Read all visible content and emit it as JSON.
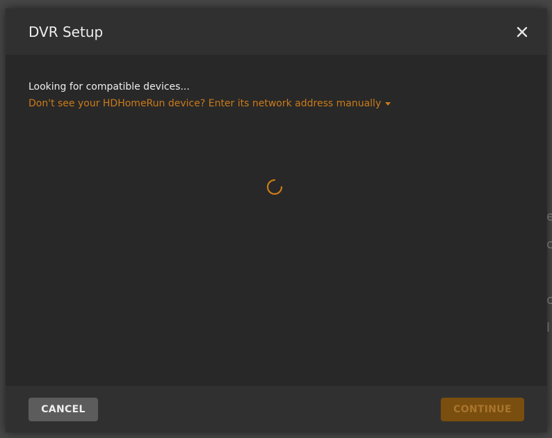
{
  "modal": {
    "title": "DVR Setup"
  },
  "body": {
    "status": "Looking for compatible devices...",
    "manual_link": "Don't see your HDHomeRun device? Enter its network address manually"
  },
  "footer": {
    "cancel_label": "CANCEL",
    "continue_label": "CONTINUE",
    "continue_disabled": true
  },
  "background": {
    "glyphs": [
      "e",
      "c",
      "c",
      "l"
    ]
  },
  "icons": {
    "close": "close-icon",
    "spinner": "loading-spinner-icon",
    "caret": "caret-down-icon"
  },
  "colors": {
    "accent": "#cc7b19",
    "modal_bg": "#282828",
    "header_bg": "#303030",
    "cancel_bg": "#5c5c5c",
    "continue_bg": "#7a4e0f"
  }
}
